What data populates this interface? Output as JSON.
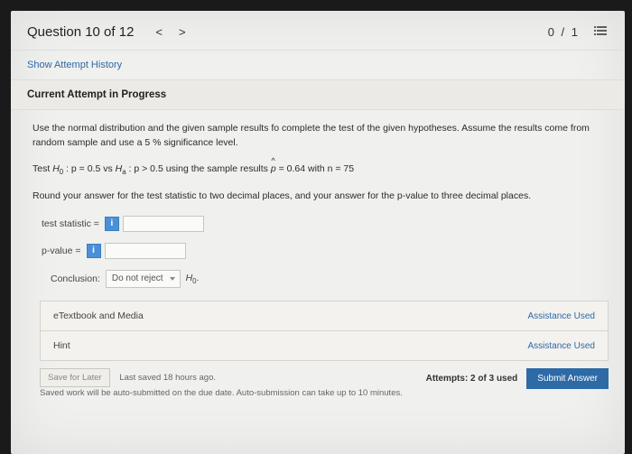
{
  "header": {
    "question_label": "Question 10 of 12",
    "prev": "<",
    "next": ">",
    "score": "0 / 1"
  },
  "history_link": "Show Attempt History",
  "attempt_header": "Current Attempt in Progress",
  "problem": {
    "intro": "Use the normal distribution and the given sample results fo complete the test of the given hypotheses. Assume the results come from random sample and use a 5 % significance level.",
    "test_line_prefix": "Test ",
    "h0": "H",
    "h0_sub": "0",
    "h0_body": " : p = 0.5 vs ",
    "ha": "H",
    "ha_sub": "a",
    "ha_body": " : p > 0.5 using the sample results ",
    "phat": "p",
    "phat_body": " = 0.64 with n = 75",
    "round": "Round your answer for the test statistic to two decimal places, and your answer for the p-value to three decimal places."
  },
  "inputs": {
    "stat_label": "test statistic =",
    "pval_label": "p-value =",
    "info": "i",
    "concl_label": "Conclusion:",
    "concl_value": "Do not reject",
    "concl_h0": "H",
    "concl_h0_sub": "0",
    "concl_dot": "."
  },
  "panel": {
    "etext": "eTextbook and Media",
    "hint": "Hint",
    "assist": "Assistance Used"
  },
  "footer": {
    "save": "Save for Later",
    "last_saved": "Last saved 18 hours ago.",
    "auto_note": "Saved work will be auto-submitted on the due date. Auto-submission can take up to 10 minutes.",
    "attempts": "Attempts: 2 of 3 used",
    "submit": "Submit Answer"
  }
}
